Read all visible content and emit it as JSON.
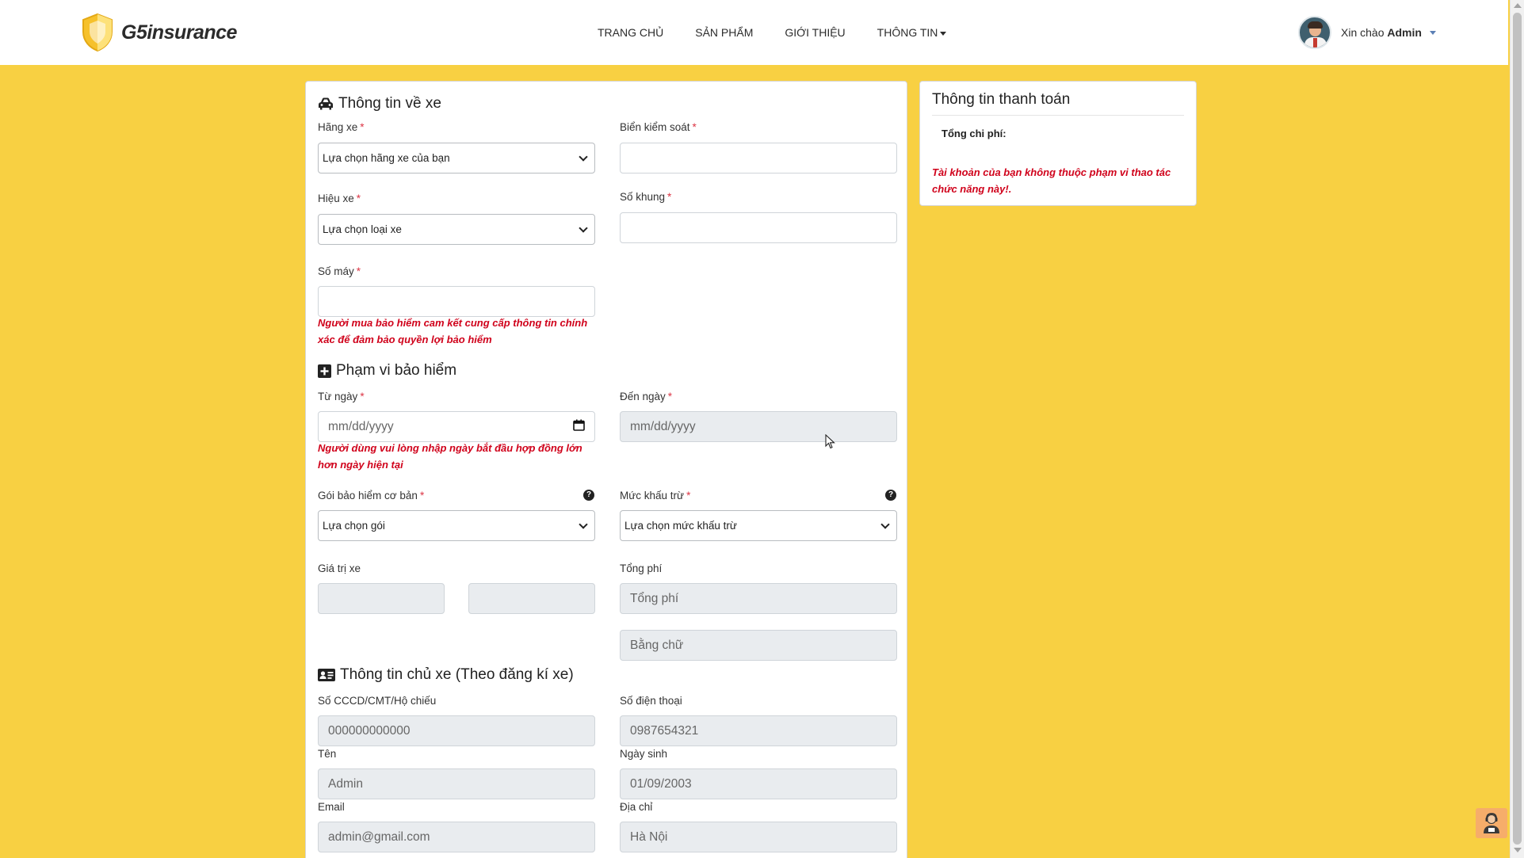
{
  "navbar": {
    "brand": "G5insurance",
    "links": [
      "TRANG CHỦ",
      "SẢN PHẨM",
      "GIỚI THIỆU",
      "THÔNG TIN"
    ],
    "greeting_prefix": "Xin chào",
    "user_name": "Admin"
  },
  "vehicle_info": {
    "title": "Thông tin về xe",
    "brand_label": "Hãng xe",
    "brand_select": "Lựa chọn hãng xe của bạn",
    "plate_label": "Biển kiểm soát",
    "model_label": "Hiệu xe",
    "model_select": "Lựa chọn loại xe",
    "chassis_label": "Số khung",
    "engine_label": "Số máy",
    "commitment_note": "Người mua bảo hiểm cam kết cung cấp thông tin chính xác để đảm bảo quyền lợi bảo hiểm"
  },
  "coverage": {
    "title": "Phạm vi bảo hiểm",
    "from_label": "Từ ngày",
    "from_placeholder": "mm/dd/yyyy",
    "from_note": "Người dùng vui lòng nhập ngày bắt đầu hợp đồng lớn hơn ngày hiện tại",
    "to_label": "Đến ngày",
    "to_placeholder": "mm/dd/yyyy",
    "package_label": "Gói bảo hiểm cơ bản",
    "package_select": "Lựa chọn gói",
    "deductible_label": "Mức khấu trừ",
    "deductible_select": "Lựa chọn mức khấu trừ",
    "vehicle_value_label": "Giá trị xe",
    "total_fee_label": "Tổng phí",
    "total_fee_placeholder": "Tổng phí",
    "in_words_placeholder": "Bằng chữ",
    "help_glyph": "?"
  },
  "owner": {
    "title": "Thông tin chủ xe (Theo đăng kí xe)",
    "id_label": "Số CCCD/CMT/Hộ chiếu",
    "id_value": "000000000000",
    "phone_label": "Số điện thoại",
    "phone_value": "0987654321",
    "name_label": "Tên",
    "name_value": "Admin",
    "dob_label": "Ngày sinh",
    "dob_value": "01/09/2003",
    "email_label": "Email",
    "email_value": "admin@gmail.com",
    "address_label": "Địa chỉ",
    "address_value": "Hà Nội"
  },
  "payment": {
    "title": "Thông tin thanh toán",
    "total_label": "Tổng chi phí:",
    "warning": "Tài khoản của bạn không thuộc phạm vi thao tác chức năng này!."
  },
  "required_mark": "*",
  "colors": {
    "page_bg": "#f8d042",
    "warning_red": "#d0021b",
    "required_red": "#dc3545"
  }
}
